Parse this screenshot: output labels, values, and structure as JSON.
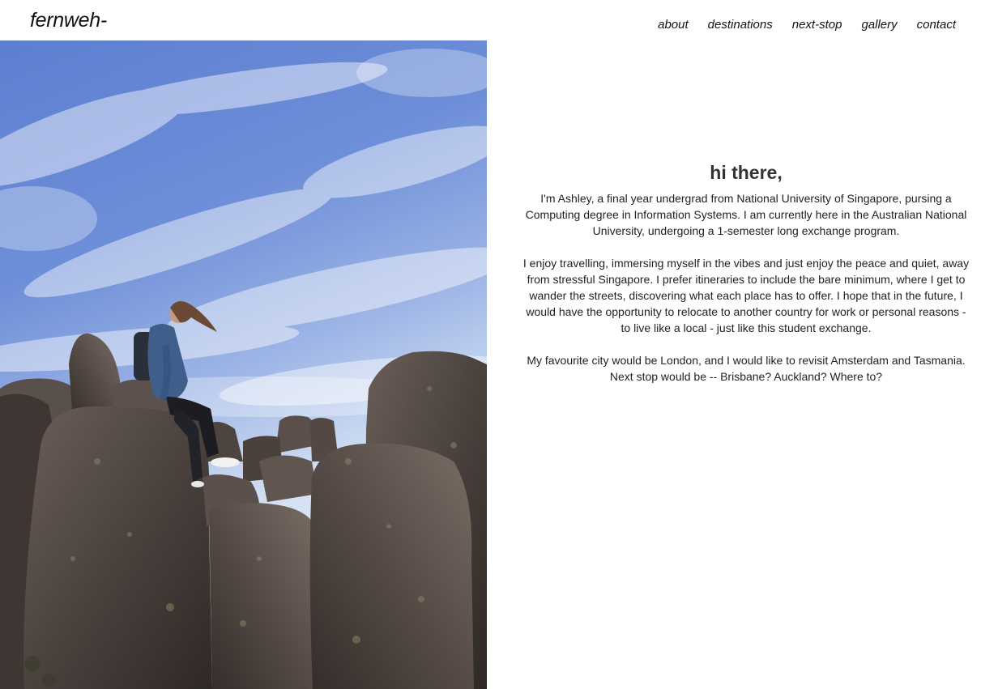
{
  "header": {
    "logo": "fernweh-",
    "nav": [
      {
        "label": "about"
      },
      {
        "label": "destinations"
      },
      {
        "label": "next-stop"
      },
      {
        "label": "gallery"
      },
      {
        "label": "contact"
      }
    ]
  },
  "hero": {
    "alt": "person sitting on large rock formations under a blue cloudy sky"
  },
  "main": {
    "greeting": "hi there,",
    "paragraphs": [
      "I'm Ashley, a final year undergrad from National University of Singapore, pursing a Computing degree in Information Systems. I am currently here in the Australian National University, undergoing a 1-semester long exchange program.",
      "I enjoy travelling, immersing myself in the vibes and just enjoy the peace and quiet, away from stressful Singapore. I prefer itineraries to include the bare minimum, where I get to wander the streets, discovering what each place has to offer. I hope that in the future, I would have the opportunity to relocate to another country for work or personal reasons - to live like a local - just like this student exchange.",
      "My favourite city would be London, and I would like to revisit Amsterdam and Tasmania. Next stop would be -- Brisbane? Auckland? Where to?"
    ]
  },
  "colors": {
    "sky_top": "#5a7bc9",
    "sky_bottom": "#c9d8ee",
    "rock": "#4a403d",
    "text": "#333333"
  }
}
